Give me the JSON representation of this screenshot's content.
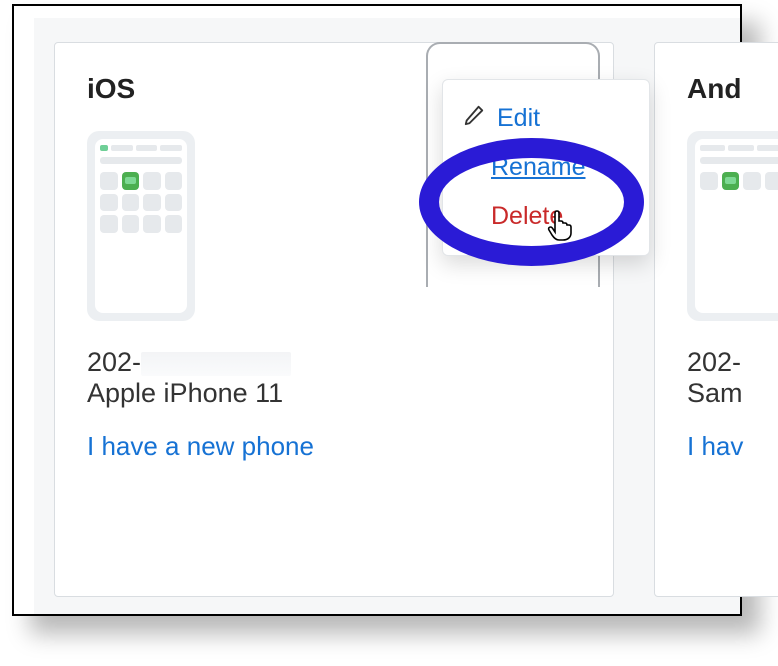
{
  "cards": {
    "ios": {
      "title": "iOS",
      "phone_prefix": "202-",
      "model": "Apple iPhone 11",
      "new_phone_link": "I have a new phone"
    },
    "android": {
      "title": "And",
      "phone_prefix": "202-",
      "model": "Sam",
      "new_phone_link": "I hav"
    }
  },
  "menu": {
    "edit": "Edit",
    "rename": "Rename",
    "delete": "Delete"
  },
  "icons": {
    "pencil": "pencil-icon",
    "pointer": "pointer-cursor"
  },
  "colors": {
    "link": "#1672d4",
    "danger": "#c92a2a",
    "highlight": "#2a1bd6"
  }
}
